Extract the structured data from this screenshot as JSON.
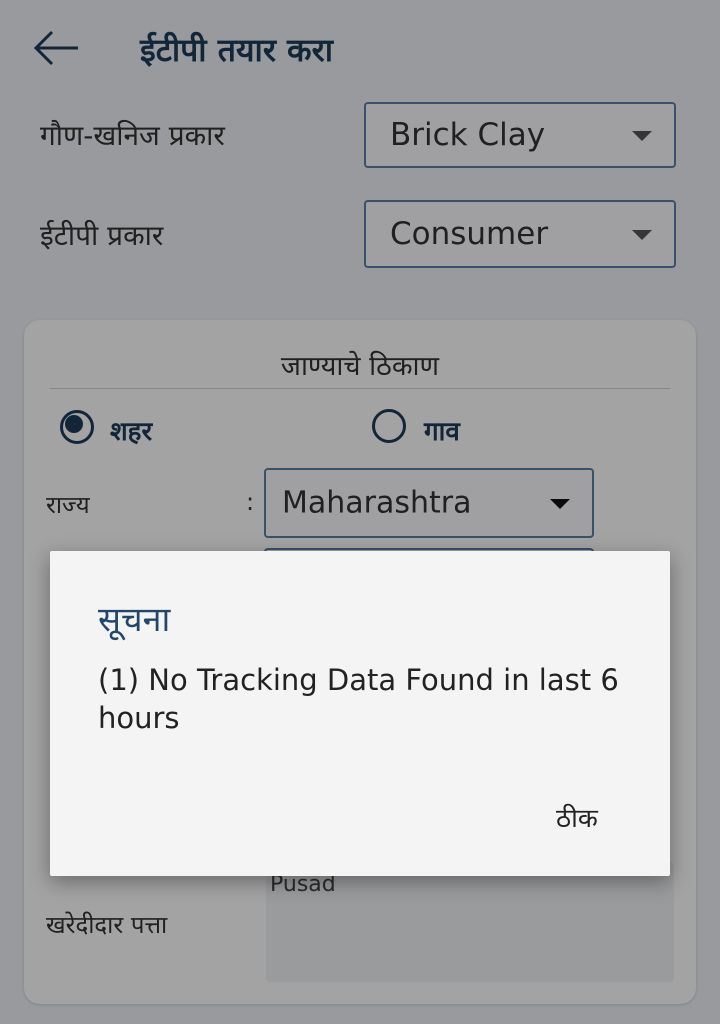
{
  "header": {
    "title": "ईटीपी तयार करा",
    "back_icon": "arrow-left-icon"
  },
  "form": {
    "minor_mineral_label": "गौण-खनिज प्रकार",
    "minor_mineral_value": "Brick Clay",
    "etp_type_label": "ईटीपी प्रकार",
    "etp_type_value": "Consumer"
  },
  "destination": {
    "title": "जाण्याचे ठिकाण",
    "radio_city": "शहर",
    "radio_village": "गाव",
    "selected": "शहर",
    "state_label": "राज्य",
    "colon": ":",
    "state_value": "Maharashtra",
    "address_label": "खरेदीदार पत्ता",
    "address_value": "Pusad"
  },
  "dialog": {
    "title": "सूचना",
    "message": "(1) No Tracking Data Found in last 6 hours",
    "ok_label": "ठीक"
  },
  "colors": {
    "accent": "#1e3c5a",
    "overlay": "rgba(0,0,0,0.36)"
  }
}
